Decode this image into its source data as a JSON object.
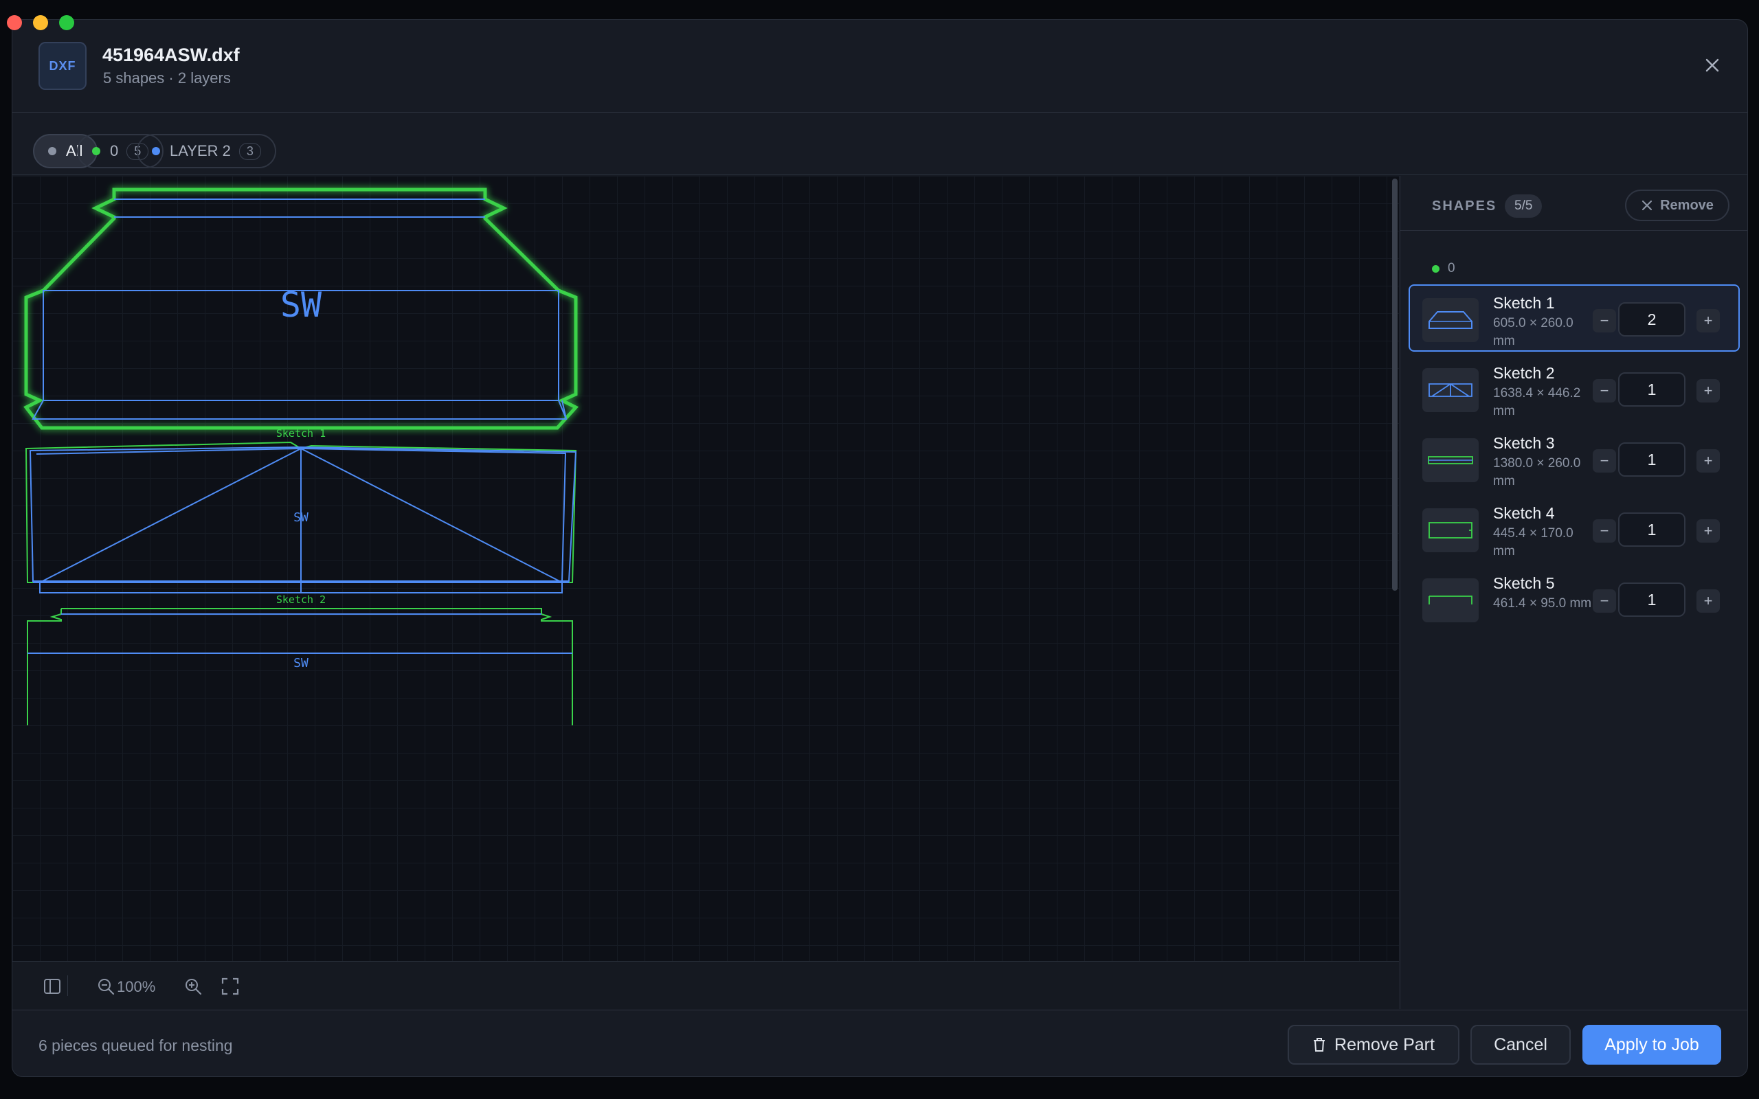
{
  "colors": {
    "accent": "#4a8cf7",
    "layer0": "#3ad24a",
    "layer2": "#4f8cf5",
    "muted": "#8b93a3"
  },
  "header": {
    "badge": "DXF",
    "title": "451964ASW.dxf",
    "subtitle": "5 shapes · 2 layers"
  },
  "filters": [
    {
      "label": "All",
      "dot": "#8b93a3"
    },
    {
      "label": "0",
      "count": "5",
      "dot": "#3ad24a"
    },
    {
      "label": "LAYER 2",
      "count": "3",
      "dot": "#4f8cf5"
    }
  ],
  "canvas": {
    "shape1_text": "SW",
    "shape1_label": "Sketch 1",
    "shape2_text": "SW",
    "shape2_label": "Sketch 2",
    "shape3_text": "SW"
  },
  "toolbar": {
    "zoom": "100%"
  },
  "sidebar": {
    "title": "SHAPES",
    "count": "5/5",
    "remove_label": "Remove",
    "group_label": "0",
    "items": [
      {
        "name": "Sketch 1",
        "dims": "605.0 × 260.0 mm",
        "qty": "2"
      },
      {
        "name": "Sketch 2",
        "dims": "1638.4 × 446.2 mm",
        "qty": "1"
      },
      {
        "name": "Sketch 3",
        "dims": "1380.0 × 260.0 mm",
        "qty": "1"
      },
      {
        "name": "Sketch 4",
        "dims": "445.4 × 170.0 mm",
        "qty": "1"
      },
      {
        "name": "Sketch 5",
        "dims": "461.4 × 95.0 mm",
        "qty": "1"
      }
    ]
  },
  "footer": {
    "status": "6 pieces queued for nesting",
    "remove_part": "Remove Part",
    "cancel": "Cancel",
    "apply": "Apply to Job"
  }
}
